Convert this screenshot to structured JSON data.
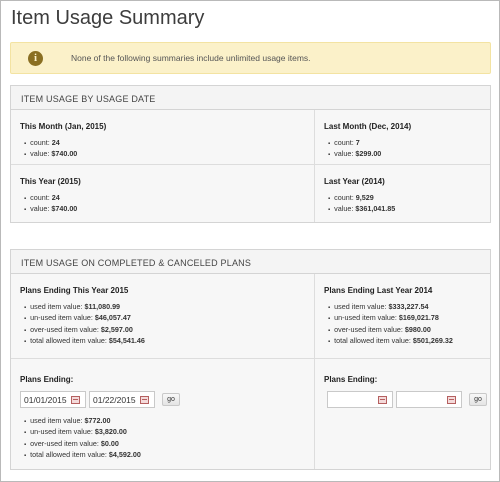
{
  "page": {
    "title": "Item Usage Summary"
  },
  "alert": {
    "text": "None of the following summaries include unlimited usage items."
  },
  "usage_by_date": {
    "header": "ITEM USAGE BY USAGE DATE",
    "this_month": {
      "title": "This Month (Jan, 2015)",
      "count_label": "count:",
      "count": "24",
      "value_label": "value:",
      "value": "$740.00"
    },
    "last_month": {
      "title": "Last Month (Dec, 2014)",
      "count_label": "count:",
      "count": "7",
      "value_label": "value:",
      "value": "$299.00"
    },
    "this_year": {
      "title": "This Year (2015)",
      "count_label": "count:",
      "count": "24",
      "value_label": "value:",
      "value": "$740.00"
    },
    "last_year": {
      "title": "Last Year (2014)",
      "count_label": "count:",
      "count": "9,529",
      "value_label": "value:",
      "value": "$361,041.85"
    }
  },
  "plans": {
    "header": "ITEM USAGE ON COMPLETED & CANCELED PLANS",
    "this_year": {
      "title": "Plans Ending This Year 2015",
      "used_label": "used item value:",
      "used": "$11,080.99",
      "unused_label": "un-used item value:",
      "unused": "$46,057.47",
      "overused_label": "over-used item value:",
      "overused": "$2,597.00",
      "total_label": "total allowed item value:",
      "total": "$54,541.46"
    },
    "last_year": {
      "title": "Plans Ending Last Year 2014",
      "used_label": "used item value:",
      "used": "$333,227.54",
      "unused_label": "un-used item value:",
      "unused": "$169,021.78",
      "overused_label": "over-used item value:",
      "overused": "$980.00",
      "total_label": "total allowed item value:",
      "total": "$501,269.32"
    },
    "custom_left": {
      "title": "Plans Ending:",
      "start_date": "01/01/2015",
      "end_date": "01/22/2015",
      "go_label": "go",
      "used_label": "used item value:",
      "used": "$772.00",
      "unused_label": "un-used item value:",
      "unused": "$3,820.00",
      "overused_label": "over-used item value:",
      "overused": "$0.00",
      "total_label": "total allowed item value:",
      "total": "$4,592.00"
    },
    "custom_right": {
      "title": "Plans Ending:",
      "start_date": "",
      "end_date": "",
      "go_label": "go"
    }
  },
  "icons": {
    "alert": "info-icon",
    "date_picker": "calendar-icon"
  },
  "colors": {
    "alert_bg": "#fbf1c9",
    "alert_icon": "#8a6f22",
    "panel_bg": "#f7f7f7"
  }
}
